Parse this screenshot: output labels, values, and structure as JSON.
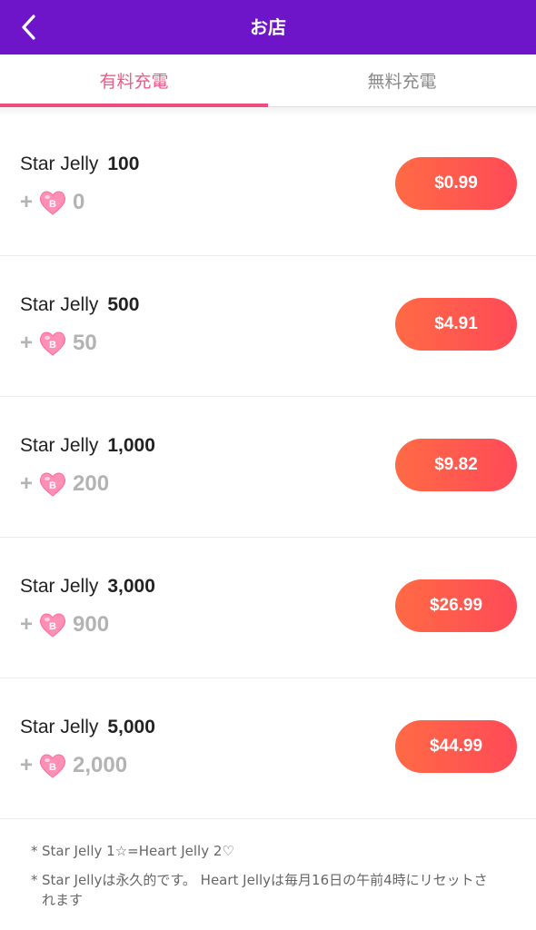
{
  "header": {
    "title": "お店",
    "back_icon": "chevron-left-icon",
    "background_color": "#6e15c9"
  },
  "tabs": [
    {
      "label": "有料充電",
      "active": true
    },
    {
      "label": "無料充電",
      "active": false
    }
  ],
  "accent_color": "#ee4c7e",
  "products": [
    {
      "label": "Star Jelly",
      "amount": "100",
      "bonus_prefix": "+",
      "bonus": "0",
      "price": "$0.99"
    },
    {
      "label": "Star Jelly",
      "amount": "500",
      "bonus_prefix": "+",
      "bonus": "50",
      "price": "$4.91"
    },
    {
      "label": "Star Jelly",
      "amount": "1,000",
      "bonus_prefix": "+",
      "bonus": "200",
      "price": "$9.82"
    },
    {
      "label": "Star Jelly",
      "amount": "3,000",
      "bonus_prefix": "+",
      "bonus": "900",
      "price": "$26.99"
    },
    {
      "label": "Star Jelly",
      "amount": "5,000",
      "bonus_prefix": "+",
      "bonus": "2,000",
      "price": "$44.99"
    }
  ],
  "bonus_icon": "heart-jelly-icon",
  "heart_icon_letter": "B",
  "notes": [
    {
      "mark": "*",
      "text": "Star Jelly 1☆=Heart Jelly 2♡"
    },
    {
      "mark": "*",
      "text": "Star Jellyは永久的です。 Heart Jellyは毎月16日の午前4時にリセットされます"
    }
  ]
}
